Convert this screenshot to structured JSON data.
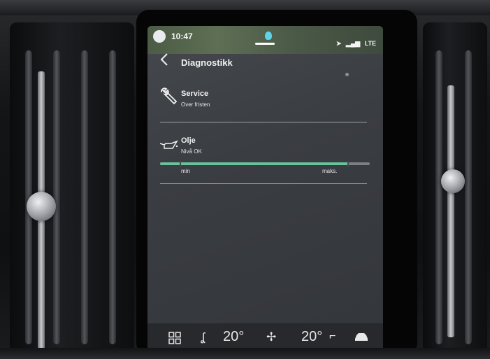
{
  "status_bar": {
    "time": "10:47",
    "network": "LTE"
  },
  "header": {
    "title": "Diagnostikk"
  },
  "service": {
    "title": "Service",
    "status": "Over fristen"
  },
  "oil": {
    "title": "Olje",
    "status": "Nivå OK",
    "level_fraction": 0.9,
    "min_label": "min",
    "max_label": "maks."
  },
  "climate": {
    "driver_temp": "20°",
    "passenger_temp": "20°"
  },
  "icons": [
    "back-icon",
    "wrench-icon",
    "oil-can-icon",
    "home-grid-icon",
    "seat-heat-icon",
    "fan-icon",
    "seat-icon",
    "car-icon",
    "navigation-icon",
    "signal-icon"
  ],
  "colors": {
    "oil_fill": "#67c39a",
    "screen_bg": "#3a3d42"
  }
}
